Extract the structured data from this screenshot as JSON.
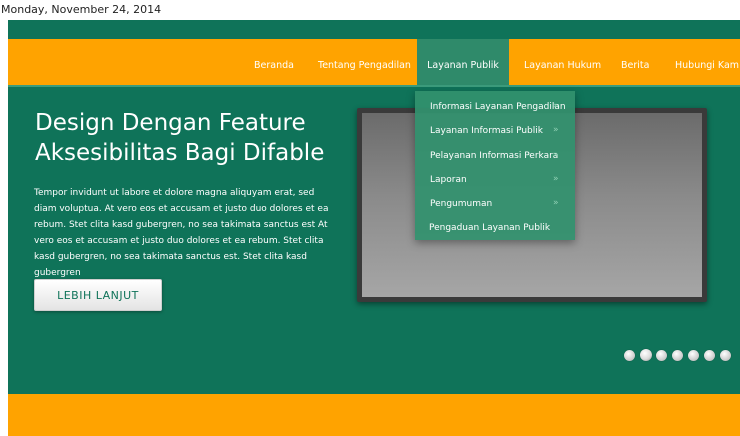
{
  "date": "Monday, November 24, 2014",
  "nav": {
    "items": [
      {
        "label": "Beranda"
      },
      {
        "label": "Tentang Pengadilan"
      },
      {
        "label": "Layanan Publik"
      },
      {
        "label": "Layanan Hukum"
      },
      {
        "label": "Berita"
      },
      {
        "label": "Hubungi Kami"
      }
    ],
    "active_index": 2
  },
  "dropdown": {
    "items": [
      {
        "label": "Informasi Layanan Pengadilan",
        "arrow": "»"
      },
      {
        "label": "Layanan Informasi Publik",
        "arrow": "»"
      },
      {
        "label": "Pelayanan Informasi Perkara",
        "arrow": "»"
      },
      {
        "label": "Laporan",
        "arrow": "»"
      },
      {
        "label": "Pengumuman",
        "arrow": "»"
      },
      {
        "label": "Pengaduan Layanan Publik"
      }
    ]
  },
  "hero": {
    "title_line1": "Design Dengan Feature",
    "title_line2": "Aksesibilitas Bagi Difable",
    "body": "Tempor invidunt ut labore et dolore magna aliquyam erat, sed diam voluptua. At vero eos et accusam et justo duo dolores et ea rebum. Stet clita kasd gubergren, no sea takimata sanctus est At vero eos et accusam et justo duo dolores et ea rebum. Stet clita kasd gubergren, no sea takimata sanctus est. Stet clita kasd gubergren",
    "button_label": "LEBIH LANJUT"
  },
  "slider": {
    "dot_count": 7,
    "active_index": 1
  },
  "colors": {
    "brand_green": "#0f7359",
    "brand_orange": "#ffa300",
    "dropdown_bg": "#32916e"
  }
}
